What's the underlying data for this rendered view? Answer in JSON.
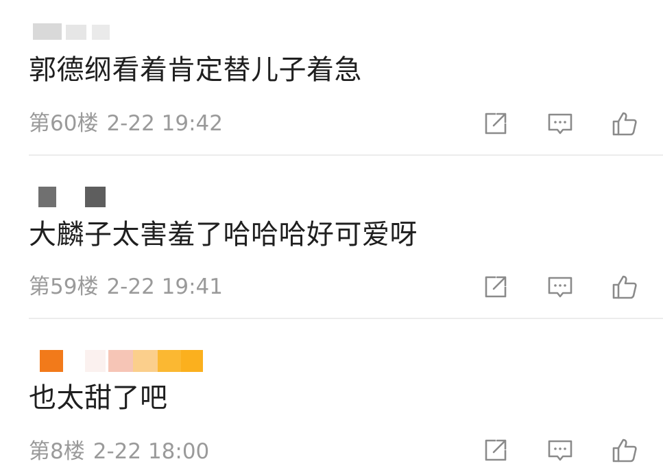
{
  "comments": [
    {
      "text": "郭德纲看着肯定替儿子着急",
      "floor": "第60楼",
      "time": "2-22 19:42"
    },
    {
      "text": "大麟子太害羞了哈哈哈好可爱呀",
      "floor": "第59楼",
      "time": "2-22 19:41"
    },
    {
      "text": "也太甜了吧",
      "floor": "第8楼",
      "time": "2-22 18:00"
    }
  ],
  "icons": {
    "share": "share-icon",
    "reply": "comment-icon",
    "like": "thumbs-up-icon"
  },
  "colors": {
    "text": "#1f1f1f",
    "meta": "#9a9a9a",
    "icon": "#8a8a8a",
    "divider": "#ececec"
  }
}
